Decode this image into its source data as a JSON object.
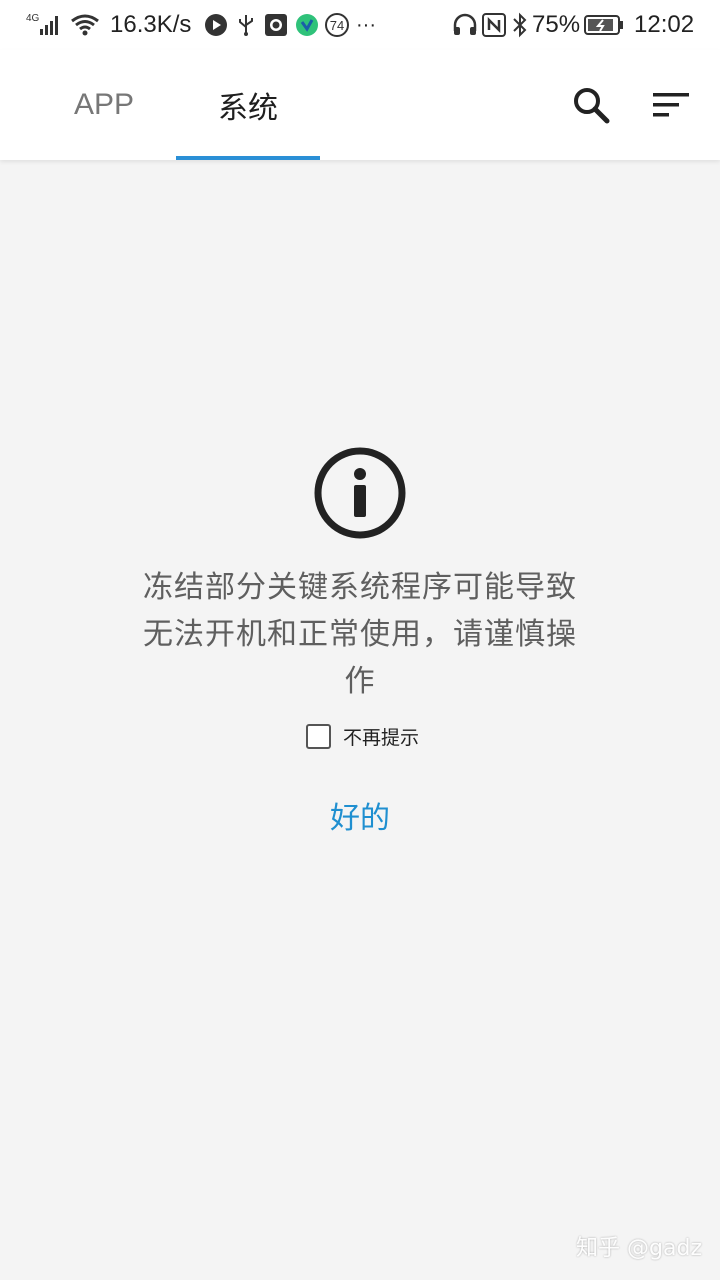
{
  "status_bar": {
    "network_type": "4G",
    "net_speed": "16.3K/s",
    "notification_count": "74",
    "more": "···",
    "battery_percent": "75%",
    "time": "12:02"
  },
  "header": {
    "tabs": [
      {
        "label": "APP",
        "active": false
      },
      {
        "label": "系统",
        "active": true
      }
    ],
    "accent_color": "#2a8fd6"
  },
  "dialog": {
    "message": "冻结部分关键系统程序可能导致无法开机和正常使用，请谨慎操作",
    "checkbox_label": "不再提示",
    "checkbox_checked": false,
    "ok_label": "好的",
    "ok_color": "#1f8fd0"
  },
  "watermark": "知乎 @gadz",
  "icons": [
    "signal-icon",
    "wifi-icon",
    "play-icon",
    "usb-icon",
    "record-icon",
    "app-icon",
    "headphones-icon",
    "nfc-icon",
    "bluetooth-icon",
    "battery-icon",
    "search-icon",
    "sort-icon",
    "info-icon"
  ]
}
